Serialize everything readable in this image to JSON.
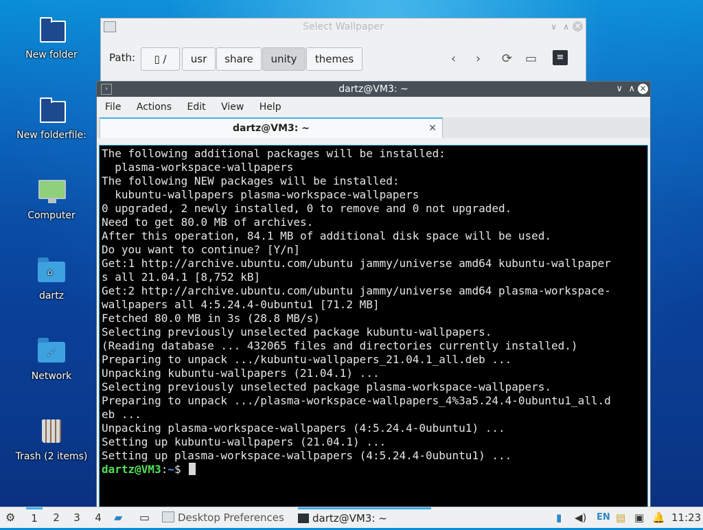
{
  "desktop": {
    "icons": [
      {
        "label": "New folder"
      },
      {
        "label": "New folderfile:"
      },
      {
        "label": "Computer"
      },
      {
        "label": "dartz"
      },
      {
        "label": "Network"
      },
      {
        "label": "Trash (2 items)"
      }
    ]
  },
  "wallpaper_dialog": {
    "title": "Select Wallpaper",
    "path_label": "Path:",
    "breadcrumbs": [
      "/",
      "usr",
      "share",
      "unity",
      "themes"
    ],
    "active_crumb": "unity"
  },
  "terminal": {
    "window_title": "dartz@VM3: ~",
    "menu": [
      "File",
      "Actions",
      "Edit",
      "View",
      "Help"
    ],
    "tab_label": "dartz@VM3: ~",
    "output": "The following additional packages will be installed:\n  plasma-workspace-wallpapers\nThe following NEW packages will be installed:\n  kubuntu-wallpapers plasma-workspace-wallpapers\n0 upgraded, 2 newly installed, 0 to remove and 0 not upgraded.\nNeed to get 80.0 MB of archives.\nAfter this operation, 84.1 MB of additional disk space will be used.\nDo you want to continue? [Y/n]\nGet:1 http://archive.ubuntu.com/ubuntu jammy/universe amd64 kubuntu-wallpaper\ns all 21.04.1 [8,752 kB]\nGet:2 http://archive.ubuntu.com/ubuntu jammy/universe amd64 plasma-workspace-\nwallpapers all 4:5.24.4-0ubuntu1 [71.2 MB]\nFetched 80.0 MB in 3s (28.8 MB/s)\nSelecting previously unselected package kubuntu-wallpapers.\n(Reading database ... 432065 files and directories currently installed.)\nPreparing to unpack .../kubuntu-wallpapers_21.04.1_all.deb ...\nUnpacking kubuntu-wallpapers (21.04.1) ...\nSelecting previously unselected package plasma-workspace-wallpapers.\nPreparing to unpack .../plasma-workspace-wallpapers_4%3a5.24.4-0ubuntu1_all.d\neb ...\nUnpacking plasma-workspace-wallpapers (4:5.24.4-0ubuntu1) ...\nSetting up kubuntu-wallpapers (21.04.1) ...\nSetting up plasma-workspace-wallpapers (4:5.24.4-0ubuntu1) ...",
    "prompt_user": "dartz@VM3",
    "prompt_sep": ":",
    "prompt_path": "~",
    "prompt_symbol": "$ "
  },
  "taskbar": {
    "workspaces": [
      "1",
      "2",
      "3",
      "4"
    ],
    "active_workspace": "1",
    "tasks": [
      {
        "label": "Desktop Preferences",
        "active": false
      },
      {
        "label": "dartz@VM3: ~",
        "active": true
      }
    ],
    "keyboard_layout": "EN",
    "clock": "11:23"
  },
  "colors": {
    "accent": "#3daee9",
    "prompt_user": "#54e05a",
    "prompt_path": "#5a8cff",
    "titlebar": "#475057"
  }
}
